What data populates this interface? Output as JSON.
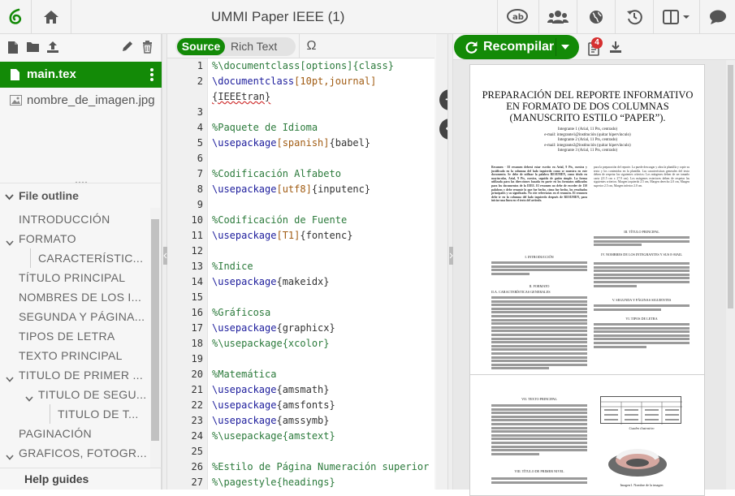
{
  "app": {
    "project_title": "UMMI Paper IEEE (1)",
    "accent_color": "#138a07",
    "toolbar_icons": [
      "overleaf-logo-icon",
      "home-icon",
      "review-icon",
      "share-icon",
      "publish-icon",
      "history-icon",
      "layout-icon",
      "chat-icon"
    ]
  },
  "file_tree": {
    "toolbar_icons": [
      "new-file-icon",
      "new-folder-icon",
      "upload-icon",
      "rename-icon",
      "delete-icon"
    ],
    "files": [
      {
        "name": "main.tex",
        "selected": true
      },
      {
        "name": "nombre_de_imagen.jpg",
        "selected": false
      }
    ]
  },
  "outline": {
    "header": "File outline",
    "items": [
      {
        "label": "INTRODUCCIÓN",
        "level": 0,
        "toggle": ""
      },
      {
        "label": "FORMATO",
        "level": 0,
        "toggle": "v"
      },
      {
        "label": "CARACTERÍSTIC...",
        "level": 1,
        "toggle": ""
      },
      {
        "label": "TÍTULO PRINCIPAL",
        "level": 0,
        "toggle": ""
      },
      {
        "label": "NOMBRES DE LOS I...",
        "level": 0,
        "toggle": ""
      },
      {
        "label": "SEGUNDA Y PÁGINA...",
        "level": 0,
        "toggle": ""
      },
      {
        "label": "TIPOS DE LETRA",
        "level": 0,
        "toggle": ""
      },
      {
        "label": "TEXTO PRINCIPAL",
        "level": 0,
        "toggle": ""
      },
      {
        "label": "TITULO DE PRIMER ...",
        "level": 0,
        "toggle": "v"
      },
      {
        "label": "TITULO DE SEGU...",
        "level": 1,
        "toggle": "v"
      },
      {
        "label": "TITULO DE T...",
        "level": 2,
        "toggle": ""
      },
      {
        "label": "PAGINACIÓN",
        "level": 0,
        "toggle": ""
      },
      {
        "label": "GRAFICOS, FOTOGR...",
        "level": 0,
        "toggle": "v"
      }
    ],
    "help_label": "Help guides"
  },
  "editor": {
    "mode_source": "Source",
    "mode_rich": "Rich Text",
    "symbol_button": "Ω",
    "lines": [
      {
        "n": "1",
        "segs": [
          {
            "t": "%\\documentclass[options]{class}",
            "c": "com"
          }
        ]
      },
      {
        "n": "2",
        "segs": [
          {
            "t": "\\documentclass",
            "c": "cmd"
          },
          {
            "t": "[10pt,journal]",
            "c": "opt"
          }
        ]
      },
      {
        "n": "",
        "segs": [
          {
            "t": "{IEEEtran}",
            "c": "squig"
          }
        ]
      },
      {
        "n": "3",
        "segs": []
      },
      {
        "n": "4",
        "segs": [
          {
            "t": "%Paquete de Idioma",
            "c": "com"
          }
        ]
      },
      {
        "n": "5",
        "segs": [
          {
            "t": "\\usepackage",
            "c": "cmd"
          },
          {
            "t": "[spanish]",
            "c": "opt"
          },
          {
            "t": "{babel}",
            "c": ""
          }
        ]
      },
      {
        "n": "6",
        "segs": []
      },
      {
        "n": "7",
        "segs": [
          {
            "t": "%Codificación Alfabeto",
            "c": "com"
          }
        ]
      },
      {
        "n": "8",
        "segs": [
          {
            "t": "\\usepackage",
            "c": "cmd"
          },
          {
            "t": "[utf8]",
            "c": "opt"
          },
          {
            "t": "{inputenc}",
            "c": ""
          }
        ]
      },
      {
        "n": "9",
        "segs": []
      },
      {
        "n": "10",
        "segs": [
          {
            "t": "%Codificación de Fuente",
            "c": "com"
          }
        ]
      },
      {
        "n": "11",
        "segs": [
          {
            "t": "\\usepackage",
            "c": "cmd"
          },
          {
            "t": "[T1]",
            "c": "opt"
          },
          {
            "t": "{fontenc}",
            "c": ""
          }
        ]
      },
      {
        "n": "12",
        "segs": []
      },
      {
        "n": "13",
        "segs": [
          {
            "t": "%Indice",
            "c": "com"
          }
        ]
      },
      {
        "n": "14",
        "segs": [
          {
            "t": "\\usepackage",
            "c": "cmd"
          },
          {
            "t": "{makeidx}",
            "c": ""
          }
        ]
      },
      {
        "n": "15",
        "segs": []
      },
      {
        "n": "16",
        "segs": [
          {
            "t": "%Gráficosa",
            "c": "com"
          }
        ]
      },
      {
        "n": "17",
        "segs": [
          {
            "t": "\\usepackage",
            "c": "cmd"
          },
          {
            "t": "{graphicx}",
            "c": ""
          }
        ]
      },
      {
        "n": "18",
        "segs": [
          {
            "t": "%\\usepackage{xcolor}",
            "c": "com"
          }
        ]
      },
      {
        "n": "19",
        "segs": []
      },
      {
        "n": "20",
        "segs": [
          {
            "t": "%Matemática",
            "c": "com"
          }
        ]
      },
      {
        "n": "21",
        "segs": [
          {
            "t": "\\usepackage",
            "c": "cmd"
          },
          {
            "t": "{amsmath}",
            "c": ""
          }
        ]
      },
      {
        "n": "22",
        "segs": [
          {
            "t": "\\usepackage",
            "c": "cmd"
          },
          {
            "t": "{amsfonts}",
            "c": ""
          }
        ]
      },
      {
        "n": "23",
        "segs": [
          {
            "t": "\\usepackage",
            "c": "cmd"
          },
          {
            "t": "{amssymb}",
            "c": ""
          }
        ]
      },
      {
        "n": "24",
        "segs": [
          {
            "t": "%\\usepackage{amstext}",
            "c": "com"
          }
        ]
      },
      {
        "n": "25",
        "segs": []
      },
      {
        "n": "26",
        "segs": [
          {
            "t": "%Estilo de Página Numeración superior",
            "c": "com"
          }
        ]
      },
      {
        "n": "27",
        "segs": [
          {
            "t": "%\\pagestyle{headings}",
            "c": "com"
          }
        ]
      }
    ]
  },
  "pdf": {
    "recompile_label": "Recompilar",
    "log_badge": "4",
    "page1": {
      "title": "PREPARACIÓN DEL REPORTE INFORMATIVO EN FORMATO DE DOS COLUMNAS (MANUSCRITO ESTILO “PAPER”).",
      "authors": [
        "Integrante 1 (Arial, 11 Pts, centrado)",
        "e-mail: integrante1@institución (quitar hipervínculo)",
        "Integrante 2 (Arial, 11 Pts, centrado)",
        "e-mail: integrante2@institución (quitar hipervínculo)",
        "Integrante 3 (Arial, 11 Pts, centrado)"
      ],
      "left_col_text": "Resumen - El resumen deberá estar escrito en Arial, 9 Pts, cursiva y justificado en la columna del lado izquierdo como se muestra en este documento. Se debe de utilizar la palabra RESUMEN, como título en mayúsculas, Arial, 9 Pts, cursiva, seguido de guión simple. La forma utilizada para las direcciones basada en parte en los formatos utilizados para los documentos de la IEEE. El resumen no debe de exceder de 150 palabras y debe resumir lo que fue hecho, cómo fue hecho, los resultados principales y su significado. No cite referencias en el resumen. El resumen debe ir en la columna del lado izquierdo después de RESUMEN, para iniciar una línea en el texto del artículo.",
      "sec_intro": "I. INTRODUCCIÓN",
      "sec_format": "II. FORMATO",
      "sec_caract": "II.A. CARACTERÍSTICAS GENERALES",
      "right_col_text": "para la preparación del reporte. La puede descargar y abra la plantilla y copie su texto y los contenidos en la plantilla. Las características generales del texto deben de respetar las siguientes criterios: Los márgenes deben de ser tamaño carta (21.5 cm x 27.9 cm). Los márgenes exteriores deben de respetar las siguientes criterios: Margen izquierdo 2.5 cm, Margen derecho 2.0 cm, Margen superior 2.5 cm, Margen inferior 2.0 cm.",
      "sec_titulo": "III. TÍTULO PRINCIPAL",
      "sec_nombres": "IV. NOMBRES DE LOS INTEGRANTES Y SUS E-MAIL",
      "sec_segunda": "V. SEGUNDA Y PÁGINAS SIGUIENTES",
      "sec_tipos": "VI. TIPOS DE LETRA"
    },
    "page2": {
      "sec_texto": "VII. TEXTO PRINCIPAL",
      "sec_primer": "VIII. TÍTULO DE PRIMER NIVEL",
      "table_caption": "Cuadro ilustrativo",
      "image_caption": "Imagen1. Nombre de la imagen"
    }
  }
}
